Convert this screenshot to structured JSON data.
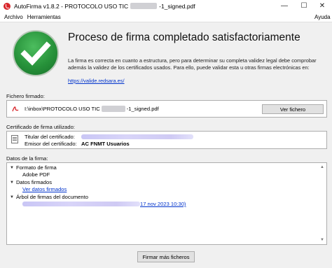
{
  "window": {
    "title_prefix": "AutoFirma v1.8.2 - PROTOCOLO USO TIC",
    "title_suffix": "-1_signed.pdf",
    "minimize": "—",
    "maximize": "☐",
    "close": "✕"
  },
  "menu": {
    "items": [
      "Archivo",
      "Herramientas",
      "Ayuda"
    ]
  },
  "result": {
    "headline": "Proceso de firma completado satisfactoriamente",
    "description": "La firma es correcta en cuanto a estructura, pero para determinar su completa validez legal debe comprobar además la validez de los certificados usados. Para ello, puede validar esta u otras firmas electrónicas en:",
    "link": "https://valide.redsara.es/"
  },
  "signed_file": {
    "label": "Fichero firmado:",
    "path_prefix": "I:\\inbox\\PROTOCOLO USO TIC",
    "path_suffix": "-1_signed.pdf",
    "button": "Ver fichero"
  },
  "certificate": {
    "label": "Certificado de firma utilizado:",
    "holder_label": "Titular del certificado:",
    "issuer_label": "Emisor del certificado:",
    "issuer_value": "AC FNMT Usuarios"
  },
  "signature_data": {
    "label": "Datos de la firma:",
    "format_label": "Formato de firma",
    "format_value": "Adobe PDF",
    "signed_data_label": "Datos firmados",
    "signed_data_link": "Ver datos firmados",
    "tree_label": "Árbol de firmas del documento",
    "tree_date": "17 nov 2023 10:30)"
  },
  "footer": {
    "button": "Firmar más ficheros"
  },
  "colors": {
    "accent_green": "#27923a",
    "link_blue": "#0033cc",
    "pdf_red": "#d8262b"
  }
}
